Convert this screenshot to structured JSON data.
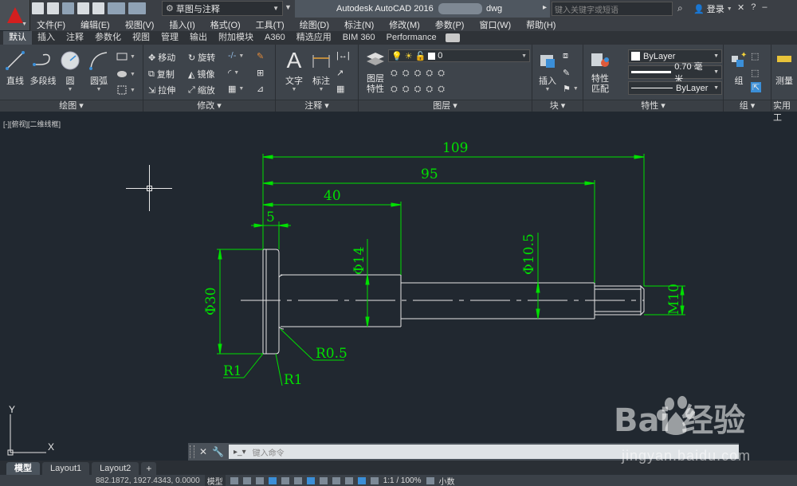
{
  "app": {
    "title": "Autodesk AutoCAD 2016",
    "file_suffix": "dwg",
    "workspace": "草图与注释",
    "search_placeholder": "键入关键字或短语",
    "login": "登录"
  },
  "menubar": [
    "文件(F)",
    "编辑(E)",
    "视图(V)",
    "插入(I)",
    "格式(O)",
    "工具(T)",
    "绘图(D)",
    "标注(N)",
    "修改(M)",
    "参数(P)",
    "窗口(W)",
    "帮助(H)"
  ],
  "ribbon_tabs": [
    "默认",
    "插入",
    "注释",
    "参数化",
    "视图",
    "管理",
    "输出",
    "附加模块",
    "A360",
    "精选应用",
    "BIM 360",
    "Performance"
  ],
  "panels": {
    "draw": {
      "title": "绘图",
      "line": "直线",
      "polyline": "多段线",
      "circle": "圆",
      "arc": "圆弧"
    },
    "modify": {
      "title": "修改",
      "move": "移动",
      "rotate": "旋转",
      "copy": "复制",
      "mirror": "镜像",
      "stretch": "拉伸",
      "scale": "缩放"
    },
    "annotation": {
      "title": "注释",
      "text": "文字",
      "dimension": "标注"
    },
    "layers": {
      "title": "图层",
      "layer_props": "图层",
      "layer_props2": "特性",
      "current_layer": "0"
    },
    "block": {
      "title": "块",
      "insert": "插入"
    },
    "properties": {
      "title": "特性",
      "match1": "特性",
      "match2": "匹配",
      "color": "ByLayer",
      "lineweight": "0.70 毫米",
      "linetype": "ByLayer"
    },
    "groups": {
      "title": "组",
      "group": "组"
    },
    "utilities": {
      "title": "实用工",
      "measure": "测量"
    }
  },
  "viewport_label": "[-][俯视][二维线框]",
  "drawing": {
    "dims": [
      "109",
      "95",
      "40",
      "5",
      "Φ14",
      "Φ10.5",
      "Φ30",
      "M10",
      "R0.5",
      "R1",
      "R1"
    ]
  },
  "ucs": {
    "y": "Y",
    "x": "X"
  },
  "command_placeholder": "键入命令",
  "layout_tabs": [
    "模型",
    "Layout1",
    "Layout2",
    "+"
  ],
  "status": {
    "coords": "882.1872, 1927.4343, 0.0000",
    "model": "模型",
    "scale": "1:1 / 100%",
    "units": "小数"
  },
  "watermark": {
    "text": "Bai 经验",
    "url": "jingyan.baidu.com"
  },
  "colors": {
    "dimension": "#00e000",
    "geometry": "#e6e6e6",
    "background": "#212830"
  }
}
